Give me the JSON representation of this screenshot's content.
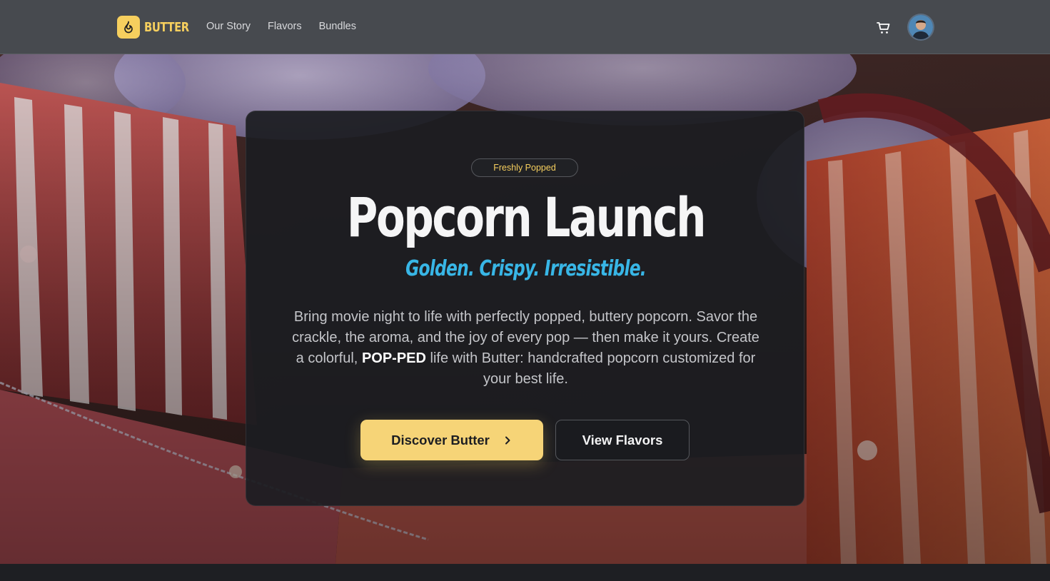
{
  "nav": {
    "brand": "BUTTER",
    "links": [
      {
        "label": "Our Story"
      },
      {
        "label": "Flavors"
      },
      {
        "label": "Bundles"
      }
    ],
    "cart_icon": "shopping-cart-icon",
    "avatar_icon": "user-avatar"
  },
  "hero": {
    "badge": "Freshly Popped",
    "title": "Popcorn Launch",
    "tagline": "Golden. Crispy. Irresistible.",
    "body_before": "Bring movie night to life with perfectly popped, buttery popcorn. Savor the crackle, the aroma, and the joy of every pop — then make it yours. Create a colorful,",
    "body_emphasis": "POP-PED",
    "body_after": "life with Butter: handcrafted popcorn customized for your best life.",
    "primary_button": "Discover Butter",
    "secondary_button": "View Flavors"
  },
  "colors": {
    "accent": "#f6cf5e",
    "tagline": "#38b6e6",
    "nav_bg": "#474a4f",
    "card_bg": "#1c1d21"
  }
}
